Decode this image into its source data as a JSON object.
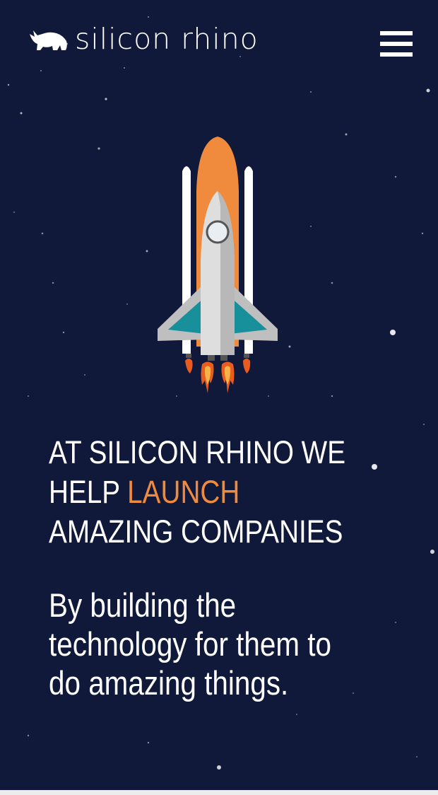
{
  "header": {
    "brand_name": "silicon rhino",
    "logo_icon": "rhino-icon",
    "menu_icon": "hamburger-menu-icon"
  },
  "hero": {
    "illustration": "rocket-icon",
    "headline": {
      "line1": "AT SILICON RHINO WE",
      "line2_prefix": "HELP ",
      "line2_accent": "LAUNCH",
      "line3": "AMAZING COMPANIES"
    },
    "subheadline": {
      "line1": "By building the",
      "line2": "technology for them to",
      "line3": "do amazing things."
    }
  },
  "colors": {
    "background": "#10193a",
    "text": "#ffffff",
    "accent": "#f08a3c",
    "footer_strip": "#ececec"
  }
}
